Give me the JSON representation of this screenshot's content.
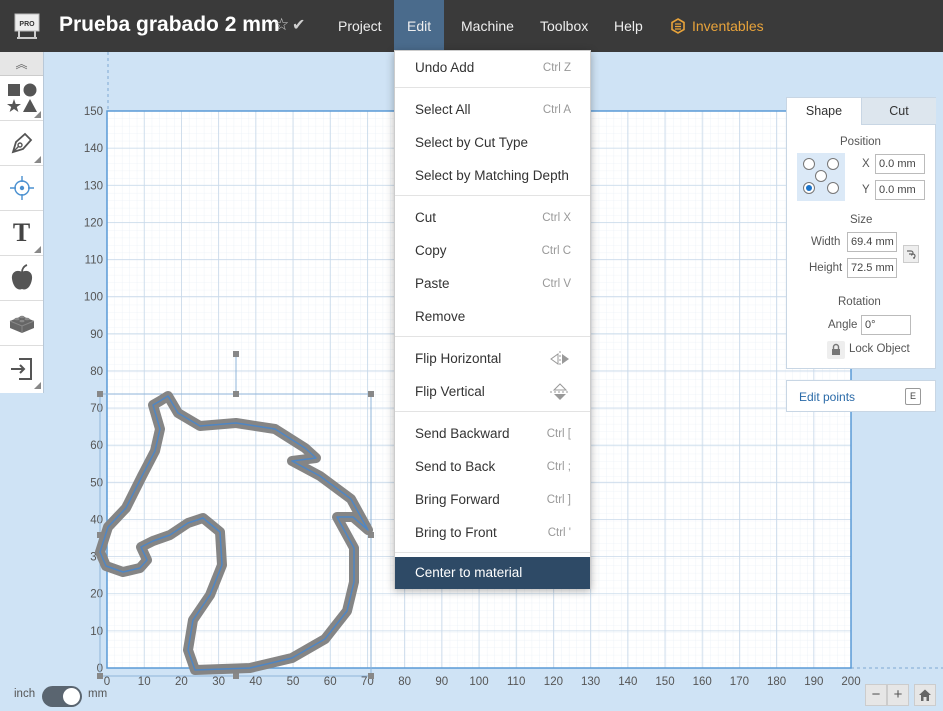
{
  "app": {
    "logo_label": "PRO",
    "title": "Prueba grabado 2 mm",
    "menus": [
      {
        "label": "Project"
      },
      {
        "label": "Edit"
      },
      {
        "label": "Machine"
      },
      {
        "label": "Toolbox"
      },
      {
        "label": "Help"
      },
      {
        "label": "Inventables"
      }
    ],
    "active_menu": "Edit",
    "accent_color": "#e8a33a",
    "menu_active_color": "#4a6b8c"
  },
  "edit_menu": {
    "items": [
      {
        "label": "Undo Add",
        "shortcut": "Ctrl Z"
      },
      {
        "label": "Select All",
        "shortcut": "Ctrl A"
      },
      {
        "label": "Select by Cut Type",
        "shortcut": ""
      },
      {
        "label": "Select by Matching Depth",
        "shortcut": ""
      },
      {
        "label": "Cut",
        "shortcut": "Ctrl X"
      },
      {
        "label": "Copy",
        "shortcut": "Ctrl C"
      },
      {
        "label": "Paste",
        "shortcut": "Ctrl V"
      },
      {
        "label": "Remove",
        "shortcut": ""
      },
      {
        "label": "Flip Horizontal",
        "icon": "flip-horizontal-icon"
      },
      {
        "label": "Flip Vertical",
        "icon": "flip-vertical-icon"
      },
      {
        "label": "Send Backward",
        "shortcut": "Ctrl ["
      },
      {
        "label": "Send to Back",
        "shortcut": "Ctrl ;"
      },
      {
        "label": "Bring Forward",
        "shortcut": "Ctrl ]"
      },
      {
        "label": "Bring to Front",
        "shortcut": "Ctrl '"
      },
      {
        "label": "Center to material",
        "shortcut": "",
        "highlighted": true
      }
    ]
  },
  "left_toolbar": {
    "tools": [
      {
        "icon": "shapes-icon"
      },
      {
        "icon": "pen-icon"
      },
      {
        "icon": "target-icon"
      },
      {
        "icon": "text-icon",
        "label": "T"
      },
      {
        "icon": "apple-icon"
      },
      {
        "icon": "lego-brick-icon"
      },
      {
        "icon": "import-icon"
      }
    ]
  },
  "canvas": {
    "x_ticks": [
      "0",
      "10",
      "20",
      "30",
      "40",
      "50",
      "60",
      "70",
      "80",
      "90",
      "100",
      "110",
      "120",
      "130",
      "140",
      "150",
      "160",
      "170",
      "180",
      "190",
      "200"
    ],
    "y_ticks": [
      "150",
      "140",
      "130",
      "120",
      "110",
      "100",
      "90",
      "80",
      "70",
      "60",
      "50",
      "40",
      "30",
      "20",
      "10",
      "0"
    ]
  },
  "shape_panel": {
    "tabs": [
      "Shape",
      "Cut"
    ],
    "active_tab": "Shape",
    "position_label": "Position",
    "x_label": "X",
    "x_value": "0.0 mm",
    "y_label": "Y",
    "y_value": "0.0 mm",
    "size_label": "Size",
    "width_label": "Width",
    "width_value": "69.4 mm",
    "height_label": "Height",
    "height_value": "72.5 mm",
    "rotation_label": "Rotation",
    "angle_label": "Angle",
    "angle_value": "0°",
    "lock_label": "Lock Object"
  },
  "edit_points": {
    "label": "Edit points",
    "key": "E"
  },
  "bottom": {
    "unit_left": "inch",
    "unit_right": "mm",
    "zoom_out": "−",
    "zoom_in": "+"
  }
}
